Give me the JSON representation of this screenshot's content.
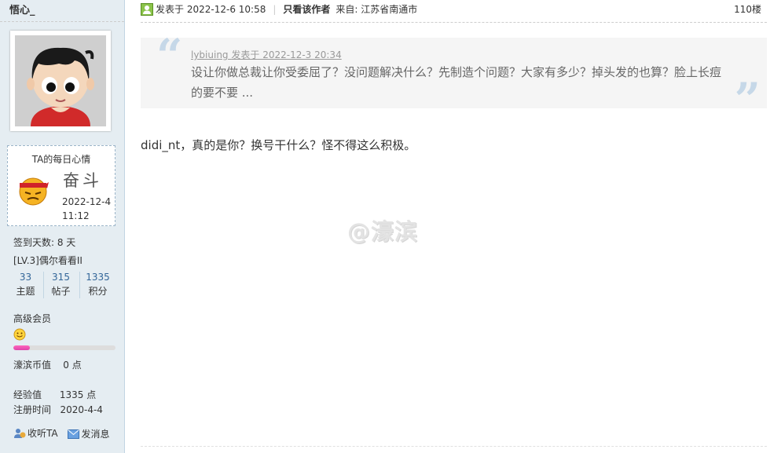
{
  "sidebar": {
    "username": "悟心_",
    "mood": {
      "title": "TA的每日心情",
      "word": "奋斗",
      "date": "2022-12-4",
      "time": "11:12",
      "icon": "fighting-emoticon-icon"
    },
    "signin": "签到天数: 8 天",
    "level": "[LV.3]偶尔看看II",
    "stats": [
      {
        "value": "33",
        "label": "主题"
      },
      {
        "value": "315",
        "label": "帖子"
      },
      {
        "value": "1335",
        "label": "积分"
      }
    ],
    "member_group": "高级会员",
    "progress_fraction": 0.16,
    "currency": {
      "label": "濠滨币值",
      "value": "0 点"
    },
    "experience": {
      "label": "经验值",
      "value": "1335 点"
    },
    "register": {
      "label": "注册时间",
      "value": "2020-4-4"
    },
    "actions": {
      "follow": "收听TA",
      "message": "发消息"
    }
  },
  "post": {
    "posted_label": "发表于",
    "posted_time": "2022-12-6 10:58",
    "author_only": "只看该作者",
    "location": "来自: 江苏省南通市",
    "floor": "110楼",
    "quote": {
      "author": "lybiuing",
      "meta": "发表于 2022-12-3 20:34",
      "text": "设让你做总裁让你受委屈了？没问题解决什么？先制造个问题？大家有多少？掉头发的也算？脸上长痘的要不要 ..."
    },
    "body": "didi_nt，真的是你？换号干什么？怪不得这么积极。",
    "watermark": "@濠滨"
  },
  "colors": {
    "sidebar_bg": "#e5edf2",
    "link_blue": "#336699",
    "progress_pink": "#dd44aa"
  }
}
